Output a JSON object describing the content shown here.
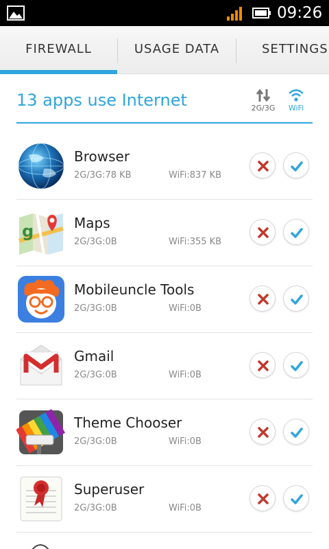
{
  "statusbar": {
    "time": "09:26",
    "icons": [
      "gallery-icon",
      "signal-icon",
      "battery-icon"
    ]
  },
  "tabs": [
    {
      "label": "FIREWALL",
      "active": true
    },
    {
      "label": "USAGE DATA",
      "active": false
    },
    {
      "label": "SETTINGS",
      "active": false
    }
  ],
  "header": {
    "title": "13 apps use Internet",
    "mobile_label": "2G/3G",
    "wifi_label": "WiFi"
  },
  "colors": {
    "accent": "#2ea5dc",
    "deny": "#c0392b",
    "allow": "#2ea5dc"
  },
  "apps": [
    {
      "name": "Browser",
      "mobile": "2G/3G:78 KB",
      "wifi": "WiFi:837 KB",
      "icon": "globe-icon"
    },
    {
      "name": "Maps",
      "mobile": "2G/3G:0B",
      "wifi": "WiFi:355 KB",
      "icon": "maps-icon"
    },
    {
      "name": "Mobileuncle Tools",
      "mobile": "2G/3G:0B",
      "wifi": "WiFi:0B",
      "icon": "face-icon"
    },
    {
      "name": "Gmail",
      "mobile": "2G/3G:0B",
      "wifi": "WiFi:0B",
      "icon": "mail-icon"
    },
    {
      "name": "Theme Chooser",
      "mobile": "2G/3G:0B",
      "wifi": "WiFi:0B",
      "icon": "paint-roller-icon"
    },
    {
      "name": "Superuser",
      "mobile": "2G/3G:0B",
      "wifi": "WiFi:0B",
      "icon": "certificate-icon"
    }
  ]
}
